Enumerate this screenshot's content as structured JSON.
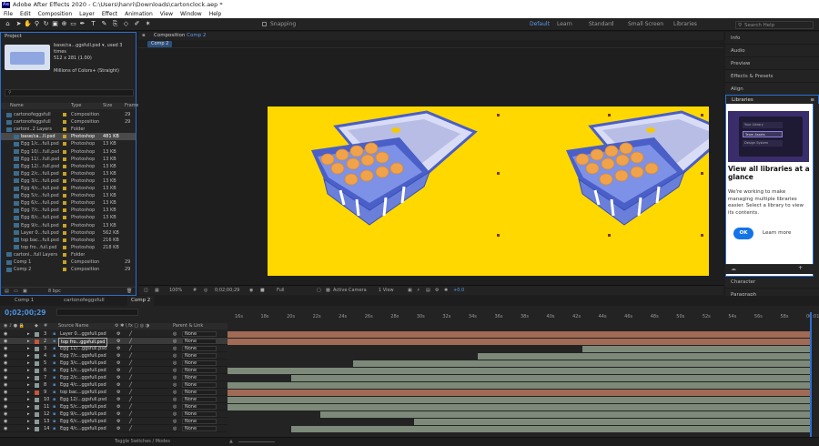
{
  "app": {
    "title": "Adobe After Effects 2020 - C:\\Users\\hanri\\Downloads\\cartonclock.aep *",
    "logo": "Ae"
  },
  "menu": [
    "File",
    "Edit",
    "Composition",
    "Layer",
    "Effect",
    "Animation",
    "View",
    "Window",
    "Help"
  ],
  "toolbar": {
    "snapping": "Snapping",
    "workspaces": [
      "Default",
      "Learn",
      "Standard",
      "Small Screen",
      "Libraries"
    ],
    "search_placeholder": "Search Help"
  },
  "project": {
    "tab": "Project",
    "info_name": "base/ca...ggsfull.psd ▾, used 3 times",
    "info_dims": "512 x 281 (1.00)",
    "info_color": "Millions of Colors+ (Straight)",
    "headers": {
      "name": "Name",
      "type": "Type",
      "size": "Size",
      "frame": "Frame"
    },
    "items": [
      {
        "name": "cartonofeggsfull",
        "type": "Composition",
        "size": "",
        "frame": "29",
        "color": "#c9a227",
        "sel": false,
        "indent": 0
      },
      {
        "name": "cartonofeggsfull",
        "type": "Composition",
        "size": "",
        "frame": "29",
        "color": "#c9a227",
        "sel": false,
        "indent": 0
      },
      {
        "name": "cartoni..2 Layers",
        "type": "Folder",
        "size": "",
        "frame": "",
        "color": "#c9a227",
        "sel": false,
        "indent": 0
      },
      {
        "name": "base/ca...ll.psd",
        "type": "Photoshop",
        "size": "481 KB",
        "frame": "",
        "color": "#c9a227",
        "sel": true,
        "indent": 1
      },
      {
        "name": "Egg 1/c...full.psd",
        "type": "Photoshop",
        "size": "13 KB",
        "frame": "",
        "color": "#c9a227",
        "sel": false,
        "indent": 1
      },
      {
        "name": "Egg 10/...full.psd",
        "type": "Photoshop",
        "size": "13 KB",
        "frame": "",
        "color": "#c9a227",
        "sel": false,
        "indent": 1
      },
      {
        "name": "Egg 11/...full.psd",
        "type": "Photoshop",
        "size": "13 KB",
        "frame": "",
        "color": "#c9a227",
        "sel": false,
        "indent": 1
      },
      {
        "name": "Egg 12/...full.psd",
        "type": "Photoshop",
        "size": "13 KB",
        "frame": "",
        "color": "#c9a227",
        "sel": false,
        "indent": 1
      },
      {
        "name": "Egg 2/c...full.psd",
        "type": "Photoshop",
        "size": "13 KB",
        "frame": "",
        "color": "#c9a227",
        "sel": false,
        "indent": 1
      },
      {
        "name": "Egg 3/c...full.psd",
        "type": "Photoshop",
        "size": "13 KB",
        "frame": "",
        "color": "#c9a227",
        "sel": false,
        "indent": 1
      },
      {
        "name": "Egg 4/c...full.psd",
        "type": "Photoshop",
        "size": "13 KB",
        "frame": "",
        "color": "#c9a227",
        "sel": false,
        "indent": 1
      },
      {
        "name": "Egg 5/c...full.psd",
        "type": "Photoshop",
        "size": "13 KB",
        "frame": "",
        "color": "#c9a227",
        "sel": false,
        "indent": 1
      },
      {
        "name": "Egg 6/c...full.psd",
        "type": "Photoshop",
        "size": "13 KB",
        "frame": "",
        "color": "#c9a227",
        "sel": false,
        "indent": 1
      },
      {
        "name": "Egg 7/c...full.psd",
        "type": "Photoshop",
        "size": "13 KB",
        "frame": "",
        "color": "#c9a227",
        "sel": false,
        "indent": 1
      },
      {
        "name": "Egg 8/c...full.psd",
        "type": "Photoshop",
        "size": "13 KB",
        "frame": "",
        "color": "#c9a227",
        "sel": false,
        "indent": 1
      },
      {
        "name": "Egg 9/c...full.psd",
        "type": "Photoshop",
        "size": "13 KB",
        "frame": "",
        "color": "#c9a227",
        "sel": false,
        "indent": 1
      },
      {
        "name": "Layer 0...full.psd",
        "type": "Photoshop",
        "size": "562 KB",
        "frame": "",
        "color": "#c9a227",
        "sel": false,
        "indent": 1
      },
      {
        "name": "top bac...full.psd",
        "type": "Photoshop",
        "size": "216 KB",
        "frame": "",
        "color": "#c9a227",
        "sel": false,
        "indent": 1
      },
      {
        "name": "top fro...full.psd",
        "type": "Photoshop",
        "size": "218 KB",
        "frame": "",
        "color": "#c9a227",
        "sel": false,
        "indent": 1
      },
      {
        "name": "cartoni...full Layers",
        "type": "Folder",
        "size": "",
        "frame": "",
        "color": "#c9a227",
        "sel": false,
        "indent": 0
      },
      {
        "name": "Comp 1",
        "type": "Composition",
        "size": "",
        "frame": "29",
        "color": "#c9a227",
        "sel": false,
        "indent": 0
      },
      {
        "name": "Comp 2",
        "type": "Composition",
        "size": "",
        "frame": "29",
        "color": "#c9a227",
        "sel": false,
        "indent": 0
      }
    ],
    "footer_bpc": "8 bpc"
  },
  "composition": {
    "tab": "Composition",
    "tab_name": "Comp 2",
    "crumb": "Comp 2",
    "footer": {
      "zoom": "100%",
      "timecode": "0;02;00;29",
      "resolution": "Full",
      "camera": "Active Camera",
      "views": "1 View",
      "exposure": "+0.0"
    }
  },
  "right_panels": [
    "Info",
    "Audio",
    "Preview",
    "Effects & Presets",
    "Align"
  ],
  "libraries": {
    "header": "Libraries",
    "title": "View all libraries at a glance",
    "body": "We're working to make managing multiple libraries easier. Select a library to view its contents.",
    "ok": "OK",
    "learn_more": "Learn more",
    "mock_items": [
      "Your Library",
      "Team Assets",
      "Design System"
    ]
  },
  "right_bottom": [
    "Character",
    "Paragraph"
  ],
  "timeline": {
    "tabs": [
      "Comp 1",
      "cartonofeggsfull",
      "Comp 2"
    ],
    "active_tab": 2,
    "timecode": "0;02;00;29",
    "headers": {
      "source": "Source Name",
      "parent": "Parent & Link"
    },
    "ruler": [
      "16s",
      "18s",
      "20s",
      "22s",
      "24s",
      "26s",
      "28s",
      "30s",
      "32s",
      "34s",
      "36s",
      "38s",
      "40s",
      "42s",
      "44s",
      "46s",
      "48s",
      "50s",
      "52s",
      "54s",
      "56s",
      "58s",
      "00:01f"
    ],
    "layers": [
      {
        "num": "3",
        "name": "Layer 0...ggsfull.psd",
        "parent": "None",
        "color": "#8a9a9a",
        "bar_start": 0.0,
        "bar_color": "#a06a55",
        "sel": false
      },
      {
        "num": "2",
        "name": "top fro...ggsfull.psd",
        "parent": "None",
        "color": "#c7553d",
        "bar_start": 0.0,
        "bar_color": "#a06a55",
        "sel": true
      },
      {
        "num": "3",
        "name": "Egg 11/...ggsfull.psd",
        "parent": "None",
        "color": "#8a9a9a",
        "bar_start": 0.61,
        "bar_color": "#7d8a7a",
        "sel": false
      },
      {
        "num": "4",
        "name": "Egg 7/c...ggsfull.psd",
        "parent": "None",
        "color": "#8a9a9a",
        "bar_start": 0.43,
        "bar_color": "#7d8a7a",
        "sel": false
      },
      {
        "num": "5",
        "name": "Egg 3/c...ggsfull.psd",
        "parent": "None",
        "color": "#8a9a9a",
        "bar_start": 0.215,
        "bar_color": "#7d8a7a",
        "sel": false
      },
      {
        "num": "6",
        "name": "Egg 1/c...ggsfull.psd",
        "parent": "None",
        "color": "#8a9a9a",
        "bar_start": 0.0,
        "bar_color": "#7d8a7a",
        "sel": false
      },
      {
        "num": "7",
        "name": "Egg 2/c...ggsfull.psd",
        "parent": "None",
        "color": "#8a9a9a",
        "bar_start": 0.11,
        "bar_color": "#7d8a7a",
        "sel": false
      },
      {
        "num": "8",
        "name": "Egg 4/c...ggsfull.psd",
        "parent": "None",
        "color": "#8a9a9a",
        "bar_start": 0.0,
        "bar_color": "#7d8a7a",
        "sel": false
      },
      {
        "num": "9",
        "name": "top bac...ggsfull.psd",
        "parent": "None",
        "color": "#c7553d",
        "bar_start": 0.0,
        "bar_color": "#a06a55",
        "sel": false
      },
      {
        "num": "10",
        "name": "Egg 12/...ggsfull.psd",
        "parent": "None",
        "color": "#8a9a9a",
        "bar_start": 0.0,
        "bar_color": "#7d8a7a",
        "sel": false
      },
      {
        "num": "11",
        "name": "Egg 5/c...ggsfull.psd",
        "parent": "None",
        "color": "#8a9a9a",
        "bar_start": 0.0,
        "bar_color": "#7d8a7a",
        "sel": false
      },
      {
        "num": "12",
        "name": "Egg 9/c...ggsfull.psd",
        "parent": "None",
        "color": "#8a9a9a",
        "bar_start": 0.16,
        "bar_color": "#7d8a7a",
        "sel": false
      },
      {
        "num": "13",
        "name": "Egg 6/c...ggsfull.psd",
        "parent": "None",
        "color": "#8a9a9a",
        "bar_start": 0.32,
        "bar_color": "#7d8a7a",
        "sel": false
      },
      {
        "num": "14",
        "name": "Egg 4/c...ggsfull.psd",
        "parent": "None",
        "color": "#8a9a9a",
        "bar_start": 0.11,
        "bar_color": "#7d8a7a",
        "sel": false
      }
    ],
    "footer": "Toggle Switches / Modes"
  }
}
